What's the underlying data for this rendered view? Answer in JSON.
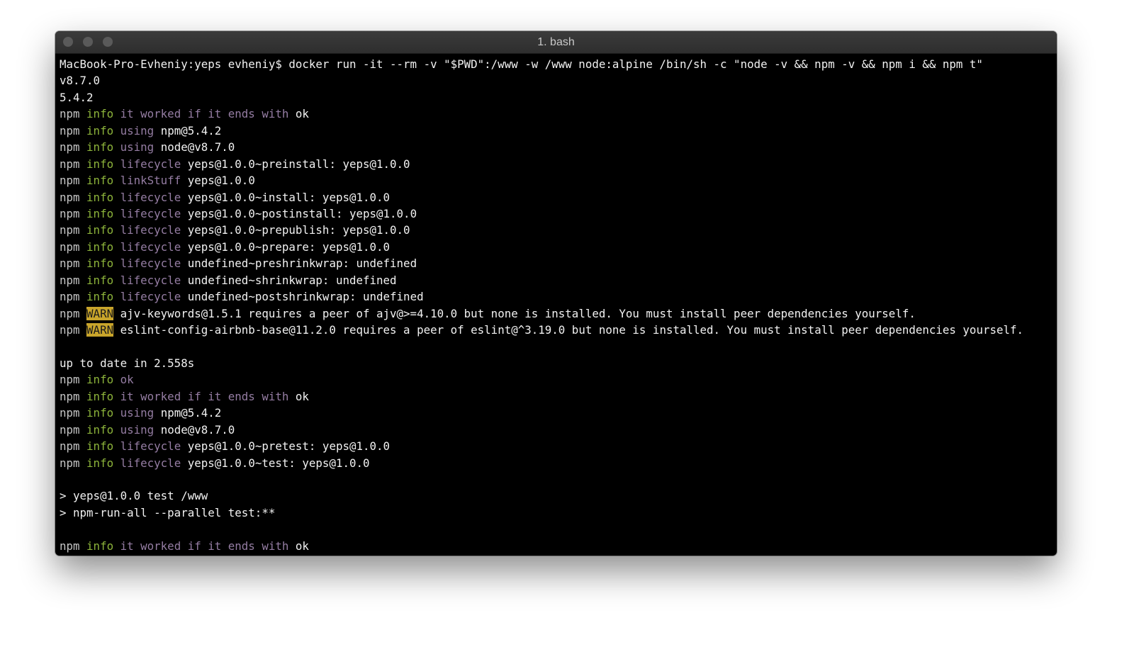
{
  "window": {
    "title": "1. bash"
  },
  "colors": {
    "info": "#8db43b",
    "message": "#957da3",
    "warn_bg": "#c9a52b"
  },
  "lines": [
    [
      {
        "t": "MacBook-Pro-Evheniy:yeps evheniy$ docker run -it --rm -v \"$PWD\":/www -w /www node:alpine /bin/sh -c \"node -v && npm -v && npm i && npm t\"",
        "c": "w"
      }
    ],
    [
      {
        "t": "v8.7.0",
        "c": "w"
      }
    ],
    [
      {
        "t": "5.4.2",
        "c": "w"
      }
    ],
    [
      {
        "t": "npm ",
        "c": "n"
      },
      {
        "t": "info ",
        "c": "i"
      },
      {
        "t": "it worked if it ends with ",
        "c": "m"
      },
      {
        "t": "ok",
        "c": "w"
      }
    ],
    [
      {
        "t": "npm ",
        "c": "n"
      },
      {
        "t": "info ",
        "c": "i"
      },
      {
        "t": "using ",
        "c": "m"
      },
      {
        "t": "npm@5.4.2",
        "c": "w"
      }
    ],
    [
      {
        "t": "npm ",
        "c": "n"
      },
      {
        "t": "info ",
        "c": "i"
      },
      {
        "t": "using ",
        "c": "m"
      },
      {
        "t": "node@v8.7.0",
        "c": "w"
      }
    ],
    [
      {
        "t": "npm ",
        "c": "n"
      },
      {
        "t": "info ",
        "c": "i"
      },
      {
        "t": "lifecycle ",
        "c": "m"
      },
      {
        "t": "yeps@1.0.0~preinstall: yeps@1.0.0",
        "c": "w"
      }
    ],
    [
      {
        "t": "npm ",
        "c": "n"
      },
      {
        "t": "info ",
        "c": "i"
      },
      {
        "t": "linkStuff ",
        "c": "m"
      },
      {
        "t": "yeps@1.0.0",
        "c": "w"
      }
    ],
    [
      {
        "t": "npm ",
        "c": "n"
      },
      {
        "t": "info ",
        "c": "i"
      },
      {
        "t": "lifecycle ",
        "c": "m"
      },
      {
        "t": "yeps@1.0.0~install: yeps@1.0.0",
        "c": "w"
      }
    ],
    [
      {
        "t": "npm ",
        "c": "n"
      },
      {
        "t": "info ",
        "c": "i"
      },
      {
        "t": "lifecycle ",
        "c": "m"
      },
      {
        "t": "yeps@1.0.0~postinstall: yeps@1.0.0",
        "c": "w"
      }
    ],
    [
      {
        "t": "npm ",
        "c": "n"
      },
      {
        "t": "info ",
        "c": "i"
      },
      {
        "t": "lifecycle ",
        "c": "m"
      },
      {
        "t": "yeps@1.0.0~prepublish: yeps@1.0.0",
        "c": "w"
      }
    ],
    [
      {
        "t": "npm ",
        "c": "n"
      },
      {
        "t": "info ",
        "c": "i"
      },
      {
        "t": "lifecycle ",
        "c": "m"
      },
      {
        "t": "yeps@1.0.0~prepare: yeps@1.0.0",
        "c": "w"
      }
    ],
    [
      {
        "t": "npm ",
        "c": "n"
      },
      {
        "t": "info ",
        "c": "i"
      },
      {
        "t": "lifecycle ",
        "c": "m"
      },
      {
        "t": "undefined~preshrinkwrap: undefined",
        "c": "w"
      }
    ],
    [
      {
        "t": "npm ",
        "c": "n"
      },
      {
        "t": "info ",
        "c": "i"
      },
      {
        "t": "lifecycle ",
        "c": "m"
      },
      {
        "t": "undefined~shrinkwrap: undefined",
        "c": "w"
      }
    ],
    [
      {
        "t": "npm ",
        "c": "n"
      },
      {
        "t": "info ",
        "c": "i"
      },
      {
        "t": "lifecycle ",
        "c": "m"
      },
      {
        "t": "undefined~postshrinkwrap: undefined",
        "c": "w"
      }
    ],
    [
      {
        "t": "npm ",
        "c": "n"
      },
      {
        "t": "WARN",
        "c": "W"
      },
      {
        "t": " ajv-keywords@1.5.1 requires a peer of ajv@>=4.10.0 but none is installed. You must install peer dependencies yourself.",
        "c": "w"
      }
    ],
    [
      {
        "t": "npm ",
        "c": "n"
      },
      {
        "t": "WARN",
        "c": "W"
      },
      {
        "t": " eslint-config-airbnb-base@11.2.0 requires a peer of eslint@^3.19.0 but none is installed. You must install peer dependencies yourself.",
        "c": "w"
      }
    ],
    [],
    [
      {
        "t": "up to date in 2.558s",
        "c": "w"
      }
    ],
    [
      {
        "t": "npm ",
        "c": "n"
      },
      {
        "t": "info ",
        "c": "i"
      },
      {
        "t": "ok",
        "c": "m"
      }
    ],
    [
      {
        "t": "npm ",
        "c": "n"
      },
      {
        "t": "info ",
        "c": "i"
      },
      {
        "t": "it worked if it ends with ",
        "c": "m"
      },
      {
        "t": "ok",
        "c": "w"
      }
    ],
    [
      {
        "t": "npm ",
        "c": "n"
      },
      {
        "t": "info ",
        "c": "i"
      },
      {
        "t": "using ",
        "c": "m"
      },
      {
        "t": "npm@5.4.2",
        "c": "w"
      }
    ],
    [
      {
        "t": "npm ",
        "c": "n"
      },
      {
        "t": "info ",
        "c": "i"
      },
      {
        "t": "using ",
        "c": "m"
      },
      {
        "t": "node@v8.7.0",
        "c": "w"
      }
    ],
    [
      {
        "t": "npm ",
        "c": "n"
      },
      {
        "t": "info ",
        "c": "i"
      },
      {
        "t": "lifecycle ",
        "c": "m"
      },
      {
        "t": "yeps@1.0.0~pretest: yeps@1.0.0",
        "c": "w"
      }
    ],
    [
      {
        "t": "npm ",
        "c": "n"
      },
      {
        "t": "info ",
        "c": "i"
      },
      {
        "t": "lifecycle ",
        "c": "m"
      },
      {
        "t": "yeps@1.0.0~test: yeps@1.0.0",
        "c": "w"
      }
    ],
    [],
    [
      {
        "t": "> yeps@1.0.0 test /www",
        "c": "w"
      }
    ],
    [
      {
        "t": "> npm-run-all --parallel test:**",
        "c": "w"
      }
    ],
    [],
    [
      {
        "t": "npm ",
        "c": "n"
      },
      {
        "t": "info ",
        "c": "i"
      },
      {
        "t": "it worked if it ends with ",
        "c": "m"
      },
      {
        "t": "ok",
        "c": "w"
      }
    ]
  ]
}
